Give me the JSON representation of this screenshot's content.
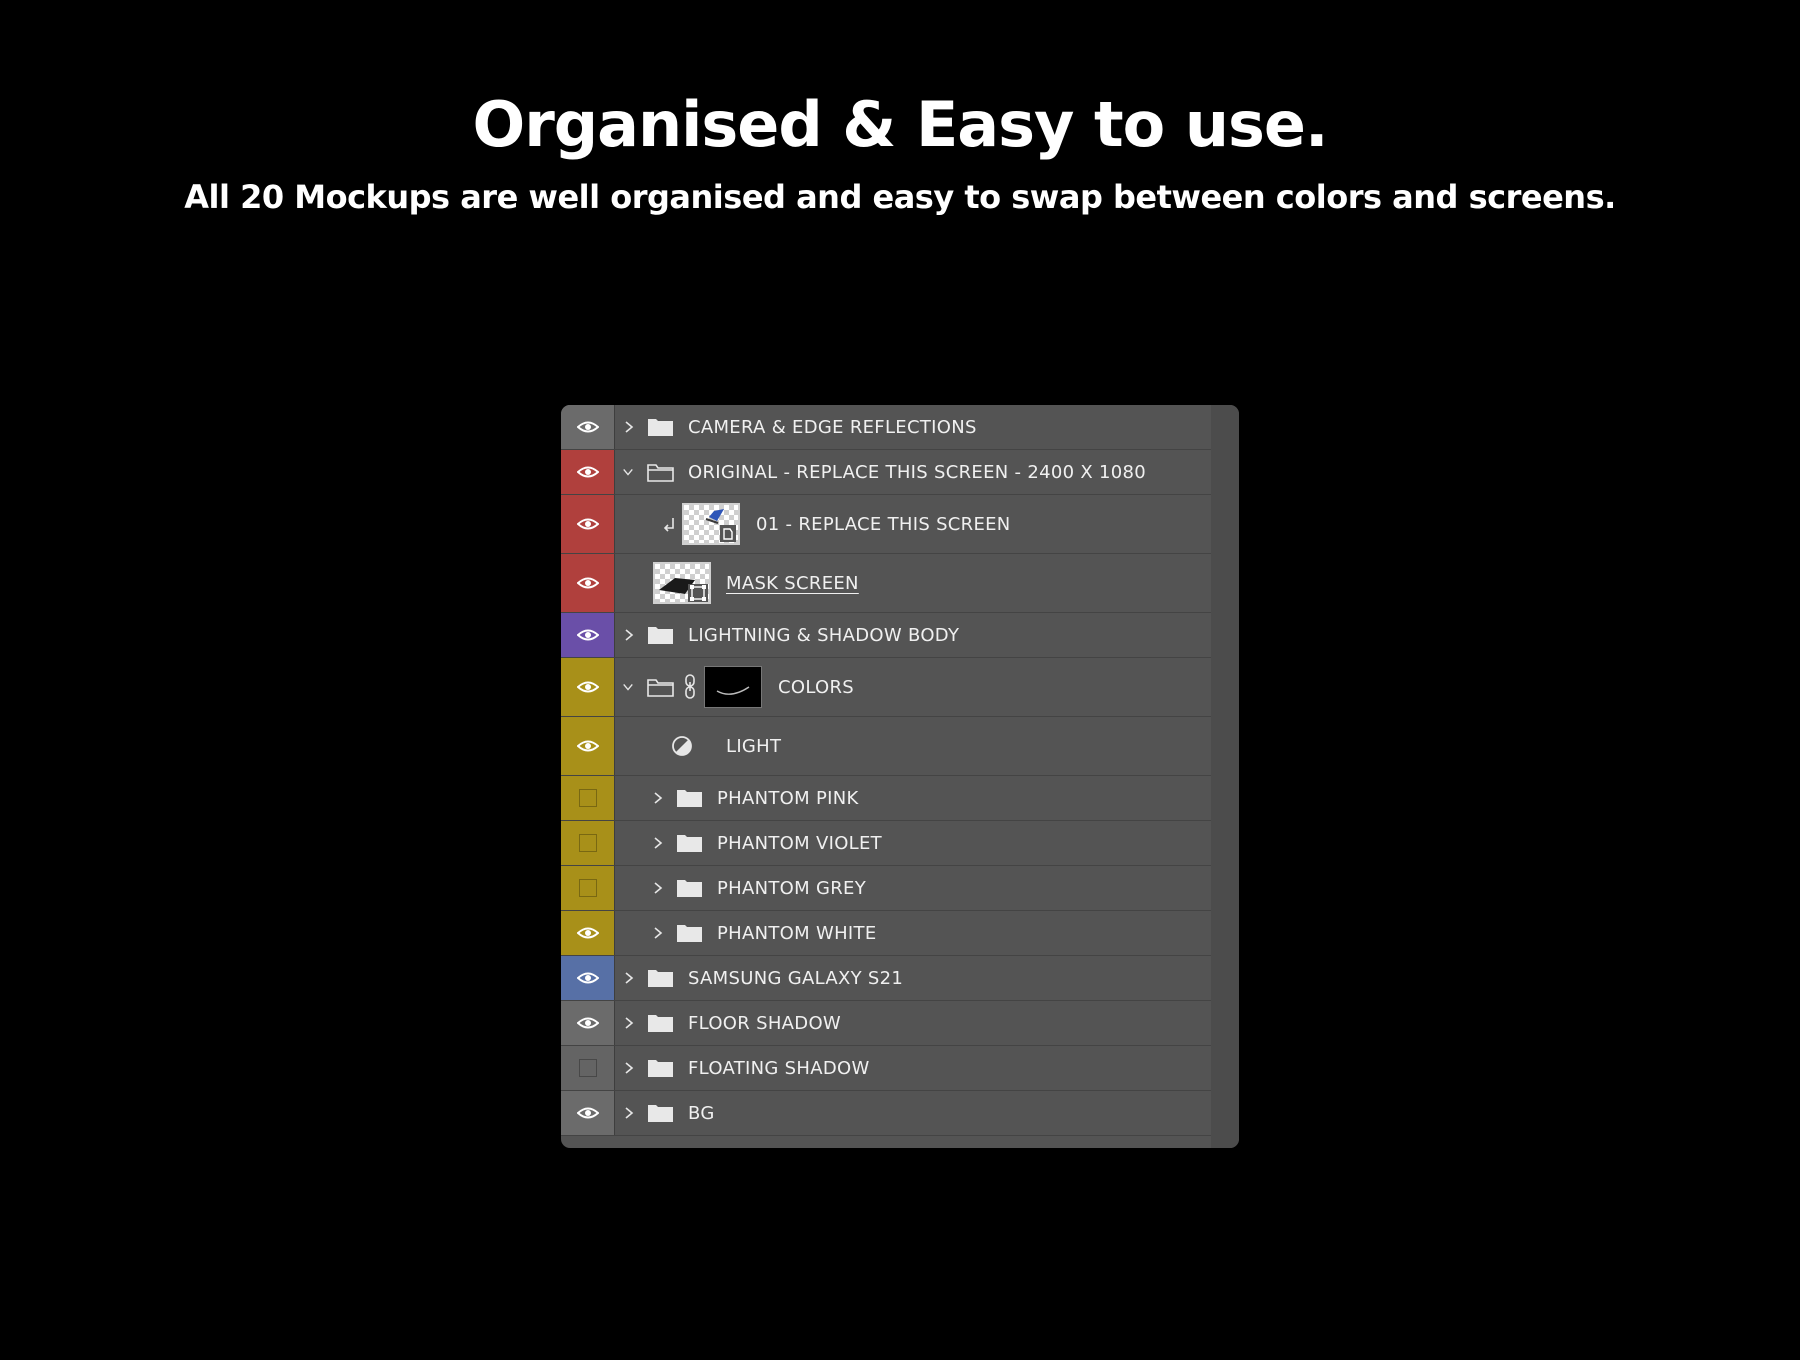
{
  "heading": "Organised & Easy to use.",
  "subheading": "All 20 Mockups are well organised and easy to swap between colors and screens.",
  "colors": {
    "gray": "#6b6b6b",
    "red": "#b0403d",
    "violet": "#6a4fa8",
    "yellow": "#a89019",
    "blue": "#5770a6",
    "empty": "#646464"
  },
  "layers": [
    {
      "label": "CAMERA & EDGE REFLECTIONS",
      "color": "gray",
      "visible": true,
      "type": "group",
      "expanded": false
    },
    {
      "label": "ORIGINAL - REPLACE THIS SCREEN - 2400 X 1080",
      "color": "red",
      "visible": true,
      "type": "group",
      "expanded": true
    },
    {
      "label": "01 - REPLACE THIS SCREEN",
      "color": "red",
      "visible": true,
      "type": "smart-object"
    },
    {
      "label": "MASK SCREEN",
      "color": "red",
      "visible": true,
      "type": "shape"
    },
    {
      "label": "LIGHTNING & SHADOW BODY",
      "color": "violet",
      "visible": true,
      "type": "group",
      "expanded": false
    },
    {
      "label": "COLORS",
      "color": "yellow",
      "visible": true,
      "type": "group-masked",
      "expanded": true
    },
    {
      "label": "LIGHT",
      "color": "yellow",
      "visible": true,
      "type": "adjustment"
    },
    {
      "label": "PHANTOM PINK",
      "color": "yellow",
      "visible": false,
      "type": "subgroup",
      "expanded": false
    },
    {
      "label": "PHANTOM VIOLET",
      "color": "yellow",
      "visible": false,
      "type": "subgroup",
      "expanded": false
    },
    {
      "label": "PHANTOM GREY",
      "color": "yellow",
      "visible": false,
      "type": "subgroup",
      "expanded": false
    },
    {
      "label": "PHANTOM WHITE",
      "color": "yellow",
      "visible": true,
      "type": "subgroup",
      "expanded": false
    },
    {
      "label": "SAMSUNG GALAXY S21",
      "color": "blue",
      "visible": true,
      "type": "group",
      "expanded": false
    },
    {
      "label": "FLOOR SHADOW",
      "color": "gray",
      "visible": true,
      "type": "group",
      "expanded": false
    },
    {
      "label": "FLOATING SHADOW",
      "color": "empty",
      "visible": false,
      "type": "group",
      "expanded": false
    },
    {
      "label": "BG",
      "color": "gray",
      "visible": true,
      "type": "group",
      "expanded": false
    }
  ]
}
